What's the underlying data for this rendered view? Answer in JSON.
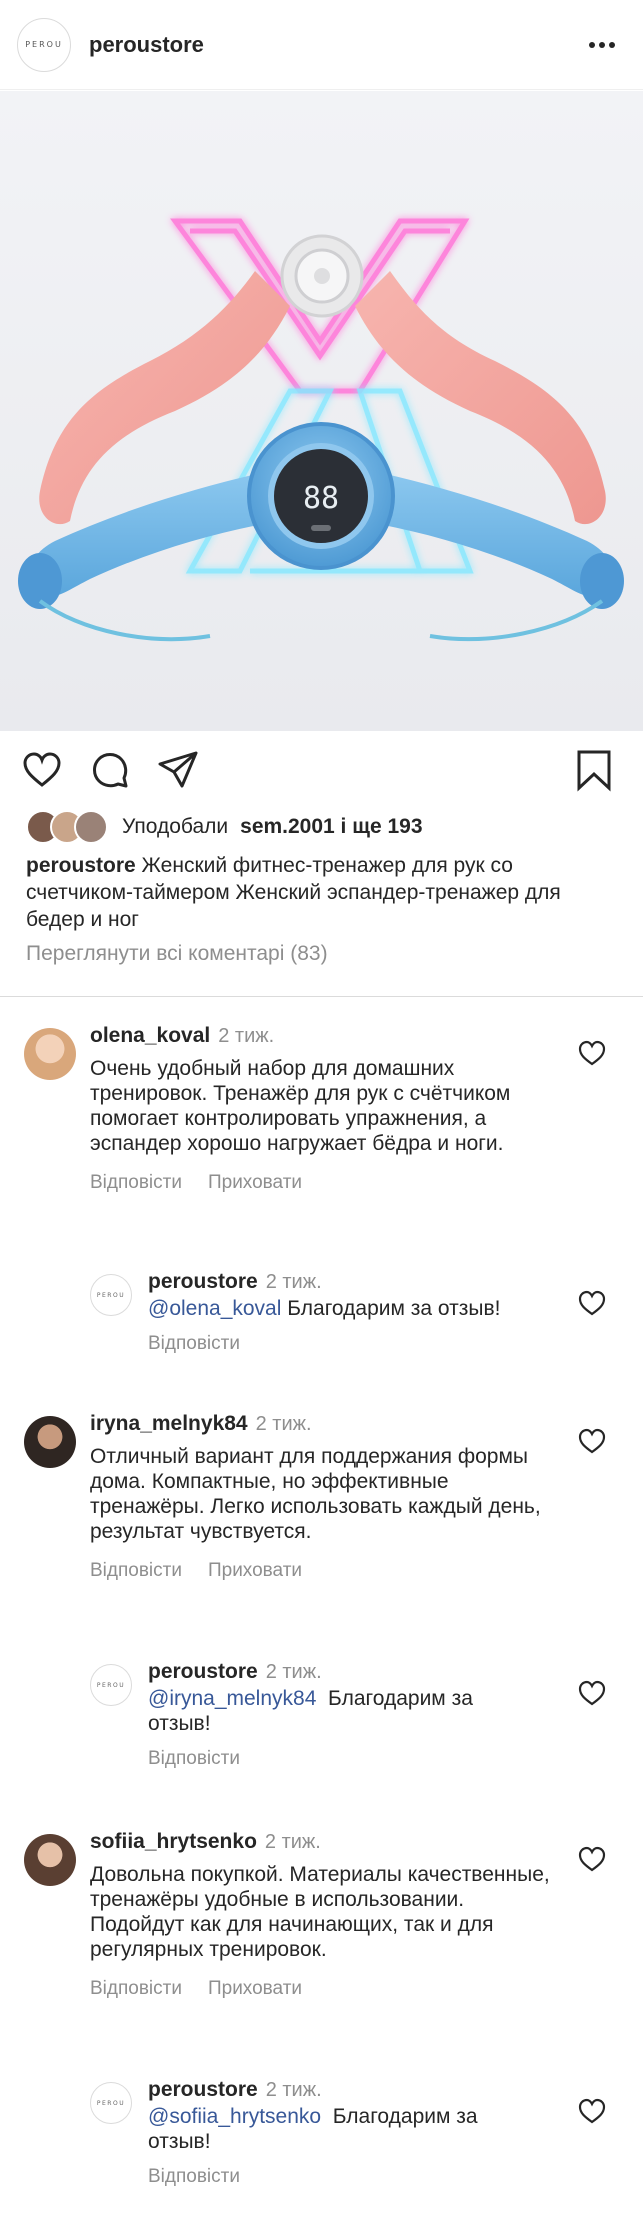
{
  "header": {
    "logo_text": "PEROU",
    "username": "peroustore"
  },
  "post": {
    "display_digits": "88"
  },
  "likes": {
    "label": "Уподобали",
    "text": "sem.2001 і ще 193"
  },
  "caption": {
    "username": "peroustore",
    "text": "Женский фитнес-тренажер для рук со счетчиком-таймером Женский эспандер-тренажер для бедер и ног"
  },
  "view_all": "Переглянути всі коментарі (83)",
  "actions": {
    "reply": "Відповісти",
    "hide": "Приховати"
  },
  "comments": [
    {
      "username": "olena_koval",
      "time": "2 тиж.",
      "text": "Очень удобный набор для домашних тренировок. Тренажёр для рук с счётчиком помогает контролировать упражнения, а эспандер хорошо нагружает бёдра и ноги.",
      "reply": {
        "username": "peroustore",
        "time": "2 тиж.",
        "mention": "@olena_koval",
        "text": " Благодарим за отзыв!"
      }
    },
    {
      "username": "iryna_melnyk84",
      "time": "2 тиж.",
      "text": "Отличный вариант для поддержания формы дома. Компактные, но эффективные тренажёры. Легко использовать каждый день, результат чувствуется.",
      "reply": {
        "username": "peroustore",
        "time": "2 тиж.",
        "mention": "@iryna_melnyk84",
        "text": "  Благодарим за отзыв!"
      }
    },
    {
      "username": "sofiia_hrytsenko",
      "time": "2 тиж.",
      "text": "Довольна покупкой. Материалы качественные, тренажёры удобные в использовании. Подойдут как для начинающих, так и для регулярных тренировок.",
      "reply": {
        "username": "peroustore",
        "time": "2 тиж.",
        "mention": "@sofiia_hrytsenko",
        "text": "  Благодарим за отзыв!"
      }
    }
  ],
  "colors": {
    "text": "#262626",
    "muted": "#8e8e8e",
    "mention": "#385898",
    "pink_device": "#f4a7a3",
    "blue_device": "#6fb6e6",
    "neon_pink": "#ff6ed6",
    "neon_cyan": "#7fe6ff"
  }
}
